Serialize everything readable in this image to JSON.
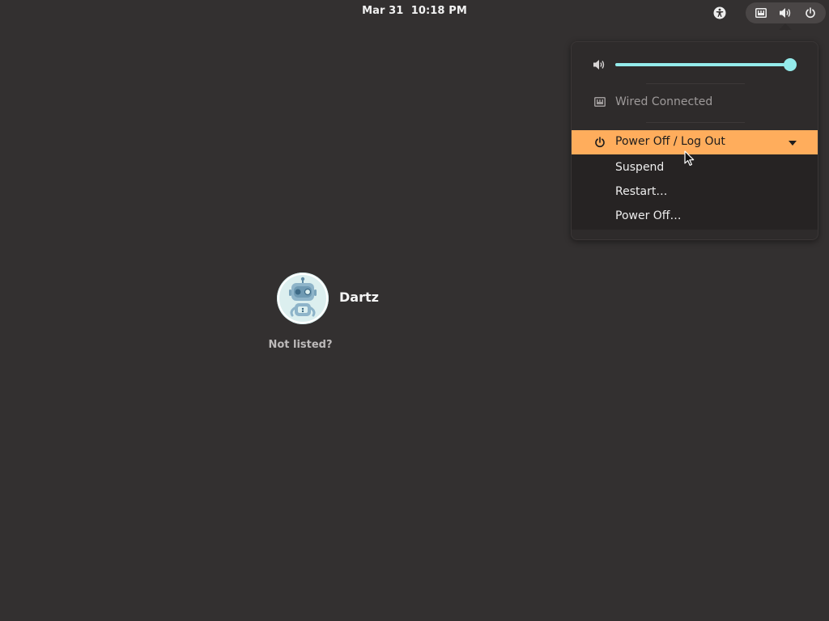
{
  "topbar": {
    "clock": "Mar 31  10:18 PM",
    "icons": {
      "accessibility": "accessibility-icon",
      "network": "network-wired-icon",
      "volume": "volume-icon",
      "power": "power-icon"
    }
  },
  "system_menu": {
    "volume": {
      "icon": "volume-icon",
      "level": 1.0,
      "accent_color": "#94ebeb"
    },
    "network": {
      "icon": "network-wired-icon",
      "label": "Wired Connected"
    },
    "power": {
      "icon": "power-icon",
      "label": "Power Off / Log Out",
      "highlight_color": "#ffad5c",
      "expanded": true,
      "items": [
        {
          "label": "Suspend"
        },
        {
          "label": "Restart…"
        },
        {
          "label": "Power Off…"
        }
      ]
    }
  },
  "users": [
    {
      "name": "Dartz",
      "avatar": "robot-avatar"
    }
  ],
  "not_listed_label": "Not listed?",
  "colors": {
    "background": "#333030",
    "popup": "#2e2b2b",
    "submenu": "#262323"
  }
}
